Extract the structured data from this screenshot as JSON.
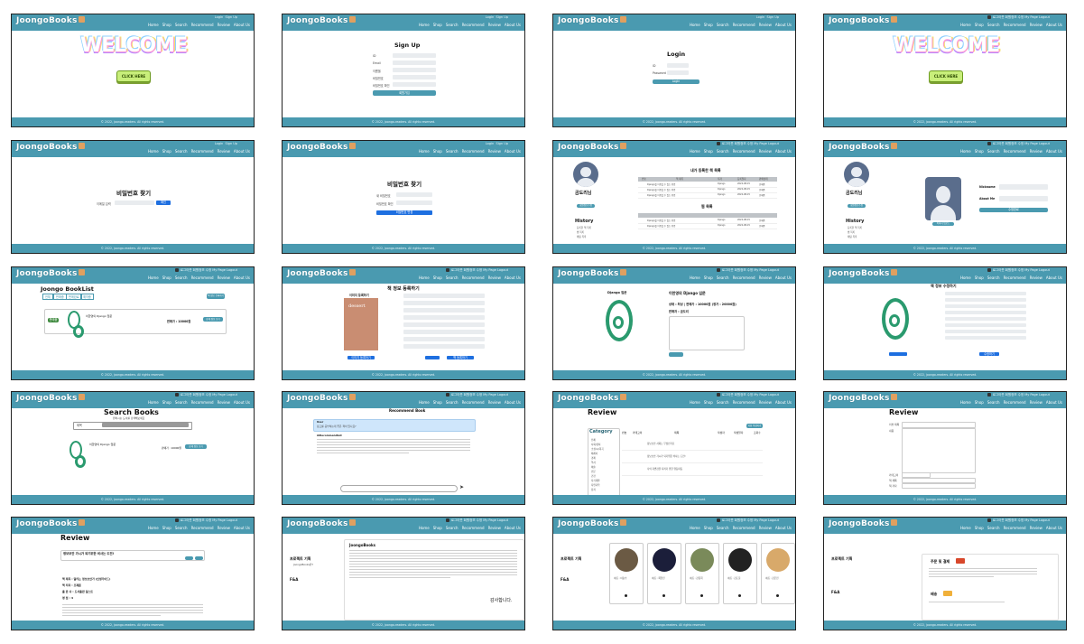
{
  "brand": "JoongoBooks",
  "footer": "© 2022, joongo-readers. All rights reserved.",
  "menu": [
    "Home",
    "Shop",
    "Search",
    "Recommend",
    "Review",
    "About Us"
  ],
  "auth_links": {
    "login": "Login",
    "signup": "Sign Up"
  },
  "user_links": "로그아웃 회원정보 수정  My Page  Logout",
  "welcome": {
    "title": "WELCOME",
    "button": "CLICK HERE"
  },
  "signup": {
    "title": "Sign Up",
    "fields": [
      "ID",
      "Email",
      "이름을",
      "비밀번호",
      "비밀번호 확인"
    ],
    "button": "회원가입"
  },
  "login": {
    "title": "Login",
    "fields": [
      "ID",
      "Password"
    ],
    "button": "Login"
  },
  "find_password": {
    "title": "비밀번호 찾기",
    "label": "이메일 입력",
    "button": "확인"
  },
  "reset_password": {
    "title": "비밀번호 찾기",
    "fields": [
      "새 비밀번호",
      "비밀번호 확인"
    ],
    "button": "비밀번호 변경"
  },
  "mypage": {
    "name": "곰도리님",
    "button": "회원정보수정",
    "history": "History",
    "history_items": [
      "등록한 책 목록",
      "찜 목록",
      "채팅 목록"
    ],
    "registered_title": "내가 등록한 책 목록",
    "wish_title": "찜 목록",
    "columns": [
      "번호",
      "책 제목",
      "저자",
      "등록일자",
      "판매상태"
    ],
    "row_title": "Django를 이용할 수 있는 방법",
    "row_author": "Django",
    "row_date": "2022-08-15",
    "row_status": "판매중"
  },
  "profile_edit": {
    "nickname_label": "Nickname",
    "about_label": "About Me",
    "button": "수정완료",
    "photo_button": "이미지 업로드"
  },
  "booklist": {
    "title": "Joongo BookList",
    "tabs": [
      "전체",
      "판매중",
      "판매완료",
      "예약중"
    ],
    "register": "책 정보 등록하기",
    "book_title": "이한영의 Django 입문",
    "price": "판매가 : 10000원",
    "detail": "상세 정보 보기"
  },
  "register": {
    "title": "책 정보 등록하기",
    "image_label": "이미지 등록하기",
    "cover_text": "dessert",
    "button": "책 등록하기"
  },
  "detail": {
    "book_title": "이한영의 Django 입문",
    "info": "상태 : 최상 | 판매가 : 10000원 (정가 : 20000원)",
    "seller": "판매자 : 곰도리",
    "cover_label": "Django 입문"
  },
  "edit": {
    "title": "책 정보 수정하기",
    "button": "수정하기"
  },
  "search": {
    "title": "Search Books",
    "subtitle": "원하시는 도서를 검색해보세요",
    "select": "제목",
    "book_title": "이한영의 Django 입문",
    "price": "판매가 : 10000원",
    "detail": "상세 정보 보기"
  },
  "recommend": {
    "title": "Recommend Book",
    "user_label": "User",
    "user_text": "장고를 공부하는데 좋은 책이 있나요?",
    "bot_label": "AiRecommendbot",
    "send_icon": "send-icon"
  },
  "review_list": {
    "title": "Review",
    "category": "Category",
    "categories": [
      "전체",
      "사회/정치",
      "소설/시/희곡",
      "에세이",
      "경제",
      "역사",
      "예술",
      "인문",
      "건강",
      "자기계발",
      "자연과학",
      "잡지"
    ],
    "columns": [
      "번호",
      "카테고리",
      "제목",
      "작성자",
      "작성일자",
      "조회수"
    ],
    "titles": [
      "정보보안 사회는 무엇인가요",
      "정보보안 가시가 되기위한 비사는 도전!",
      "나의 자존감을 지키기 위한 행동파동"
    ],
    "write": "리뷰 작성하기"
  },
  "review_write": {
    "title": "Review",
    "labels": [
      "리뷰 제목",
      "내용",
      "카테고리",
      "책 제목",
      "책 저자",
      "출판사",
      "평점"
    ]
  },
  "review_detail": {
    "title": "Review",
    "post_title": "정보보안 가시가 되기위한 비사는 도전!",
    "book": "책 제목 : 달리는 정보보안가 (인생가이드)",
    "author": "책 저자 : 조재훈",
    "publisher": "출 판 사 : 도서출판 일스트",
    "rating": "평 점 : 4"
  },
  "about": {
    "project": "프로젝트 기획",
    "members": "JoongoBooks만?",
    "fna": "F&A",
    "heading": "JoongoBooks",
    "thanks": "감사합니다."
  },
  "team": {
    "project": "프로젝트 기획",
    "fna": "F&A",
    "members": [
      "이름 : 이승수",
      "이름 : 최현진",
      "이름 : 강봉희",
      "이름 : 김도윤",
      "이름 : 김은진"
    ],
    "github_icon": "github-icon"
  },
  "payment": {
    "project": "프로젝트 기획",
    "fna": "F&A",
    "section1": "주문 및 결제",
    "section2": "배송"
  }
}
